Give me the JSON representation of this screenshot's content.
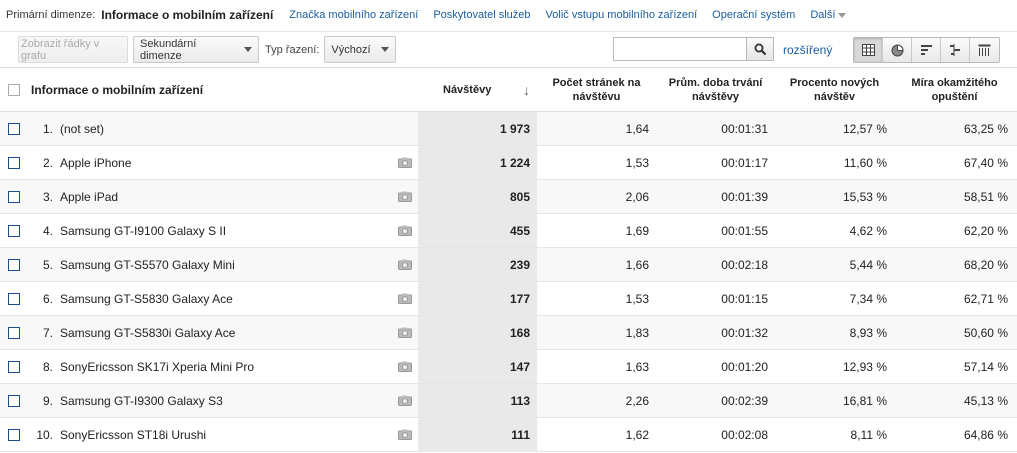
{
  "dimbar": {
    "label": "Primární dimenze:",
    "active": "Informace o mobilním zařízení",
    "links": [
      "Značka mobilního zařízení",
      "Poskytovatel služeb",
      "Volič vstupu mobilního zařízení",
      "Operační systém"
    ],
    "more": "Další"
  },
  "toolbar": {
    "plot_rows": "Zobrazit řádky v grafu",
    "secondary": "Sekundární dimenze",
    "sort_label": "Typ řazení:",
    "sort_value": "Výchozí",
    "search_value": "",
    "advanced": "rozšířený",
    "views": [
      "table-icon",
      "pie-icon",
      "bar-icon",
      "comparison-icon",
      "pivot-icon"
    ]
  },
  "table": {
    "headers": {
      "name": "Informace o mobilním zařízení",
      "visits": "Návštěvy",
      "pages": "Počet stránek na návštěvu",
      "duration": "Prům. doba trvání návštěvy",
      "new": "Procento nových návštěv",
      "bounce": "Míra okamžitého opuštění"
    },
    "rows": [
      {
        "idx": "1.",
        "name": "(not set)",
        "cam": false,
        "visits": "1 973",
        "pages": "1,64",
        "duration": "00:01:31",
        "new": "12,57 %",
        "bounce": "63,25 %"
      },
      {
        "idx": "2.",
        "name": "Apple iPhone",
        "cam": true,
        "visits": "1 224",
        "pages": "1,53",
        "duration": "00:01:17",
        "new": "11,60 %",
        "bounce": "67,40 %"
      },
      {
        "idx": "3.",
        "name": "Apple iPad",
        "cam": true,
        "visits": "805",
        "pages": "2,06",
        "duration": "00:01:39",
        "new": "15,53 %",
        "bounce": "58,51 %"
      },
      {
        "idx": "4.",
        "name": "Samsung GT-I9100 Galaxy S II",
        "cam": true,
        "visits": "455",
        "pages": "1,69",
        "duration": "00:01:55",
        "new": "4,62 %",
        "bounce": "62,20 %"
      },
      {
        "idx": "5.",
        "name": "Samsung GT-S5570 Galaxy Mini",
        "cam": true,
        "visits": "239",
        "pages": "1,66",
        "duration": "00:02:18",
        "new": "5,44 %",
        "bounce": "68,20 %"
      },
      {
        "idx": "6.",
        "name": "Samsung GT-S5830 Galaxy Ace",
        "cam": true,
        "visits": "177",
        "pages": "1,53",
        "duration": "00:01:15",
        "new": "7,34 %",
        "bounce": "62,71 %"
      },
      {
        "idx": "7.",
        "name": "Samsung GT-S5830i Galaxy Ace",
        "cam": true,
        "visits": "168",
        "pages": "1,83",
        "duration": "00:01:32",
        "new": "8,93 %",
        "bounce": "50,60 %"
      },
      {
        "idx": "8.",
        "name": "SonyEricsson SK17i Xperia Mini Pro",
        "cam": true,
        "visits": "147",
        "pages": "1,63",
        "duration": "00:01:20",
        "new": "12,93 %",
        "bounce": "57,14 %"
      },
      {
        "idx": "9.",
        "name": "Samsung GT-I9300 Galaxy S3",
        "cam": true,
        "visits": "113",
        "pages": "2,26",
        "duration": "00:02:39",
        "new": "16,81 %",
        "bounce": "45,13 %"
      },
      {
        "idx": "10.",
        "name": "SonyEricsson ST18i Urushi",
        "cam": true,
        "visits": "111",
        "pages": "1,62",
        "duration": "00:02:08",
        "new": "8,11 %",
        "bounce": "64,86 %"
      }
    ]
  }
}
